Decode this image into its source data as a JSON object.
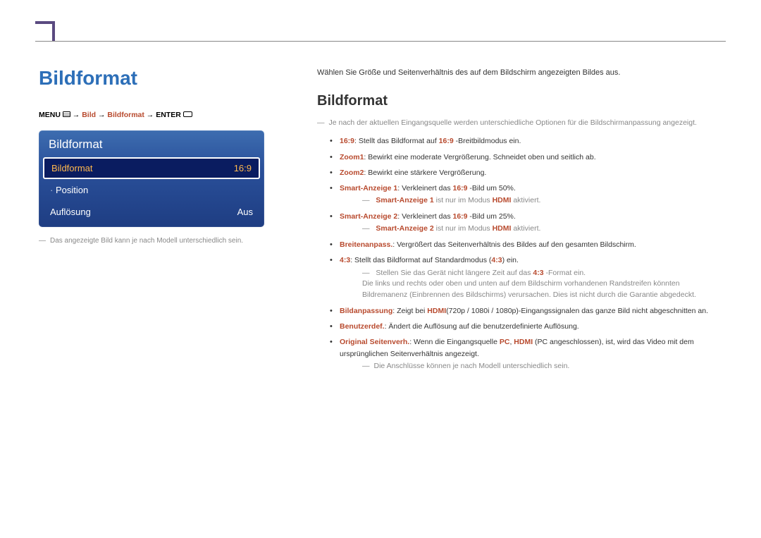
{
  "left": {
    "title": "Bildformat",
    "breadcrumb": {
      "menu": "MENU",
      "arrow": " → ",
      "path1": "Bild",
      "path2": "Bildformat",
      "enter": "ENTER"
    },
    "osd": {
      "title": "Bildformat",
      "row1_label": "Bildformat",
      "row1_value": "16:9",
      "row2_label": "Position",
      "row3_label": "Auflösung",
      "row3_value": "Aus"
    },
    "footnote": "Das angezeigte Bild kann je nach Modell unterschiedlich sein."
  },
  "right": {
    "intro": "Wählen Sie Größe und Seitenverhältnis des auf dem Bildschirm angezeigten Bildes aus.",
    "sub_title": "Bildformat",
    "top_note": "Je nach der aktuellen Eingangsquelle werden unterschiedliche Optionen für die Bildschirmanpassung angezeigt.",
    "items": {
      "l1a": "16:9",
      "l1b": ": Stellt das Bildformat auf ",
      "l1c": "16:9",
      "l1d": " -Breitbildmodus ein.",
      "l2a": "Zoom1",
      "l2b": ": Bewirkt eine moderate Vergrößerung. Schneidet oben und seitlich ab.",
      "l3a": "Zoom2",
      "l3b": ": Bewirkt eine stärkere Vergrößerung.",
      "l4a": "Smart-Anzeige 1",
      "l4b": ": Verkleinert das ",
      "l4c": "16:9",
      "l4d": " -Bild um 50%.",
      "n4a": "Smart-Anzeige 1",
      "n4b": " ist nur im Modus ",
      "n4c": "HDMI",
      "n4d": " aktiviert.",
      "l5a": "Smart-Anzeige 2",
      "l5b": ": Verkleinert das ",
      "l5c": "16:9",
      "l5d": " -Bild um 25%.",
      "n5a": "Smart-Anzeige 2",
      "n5b": " ist nur im Modus ",
      "n5c": "HDMI",
      "n5d": " aktiviert.",
      "l6a": "Breitenanpass.",
      "l6b": ": Vergrößert das Seitenverhältnis des Bildes auf den gesamten Bildschirm.",
      "l7a": "4:3",
      "l7b": ": Stellt das Bildformat auf Standardmodus (",
      "l7c": "4:3",
      "l7d": ") ein.",
      "n7": "Stellen Sie das Gerät nicht längere Zeit auf das ",
      "n7b": "4:3",
      "n7c": " -Format ein.",
      "n7_2": "Die links und rechts oder oben und unten auf dem Bildschirm vorhandenen Randstreifen könnten Bildremanenz (Einbrennen des Bildschirms) verursachen. Dies ist nicht durch die Garantie abgedeckt.",
      "l8a": "Bildanpassung",
      "l8b": ": Zeigt bei ",
      "l8c": "HDMI",
      "l8d": "(720p / 1080i / 1080p)-Eingangssignalen das ganze Bild nicht abgeschnitten an.",
      "l9a": "Benutzerdef.",
      "l9b": ": Ändert die Auflösung auf die benutzerdefinierte Auflösung.",
      "l10a": "Original Seitenverh.",
      "l10b": ": Wenn die Eingangsquelle ",
      "l10c": "PC",
      "l10d": ", ",
      "l10e": "HDMI",
      "l10f": " (PC angeschlossen), ist, wird das Video mit dem ursprünglichen Seitenverhältnis angezeigt.",
      "n10": "Die Anschlüsse können je nach Modell unterschiedlich sein."
    }
  }
}
